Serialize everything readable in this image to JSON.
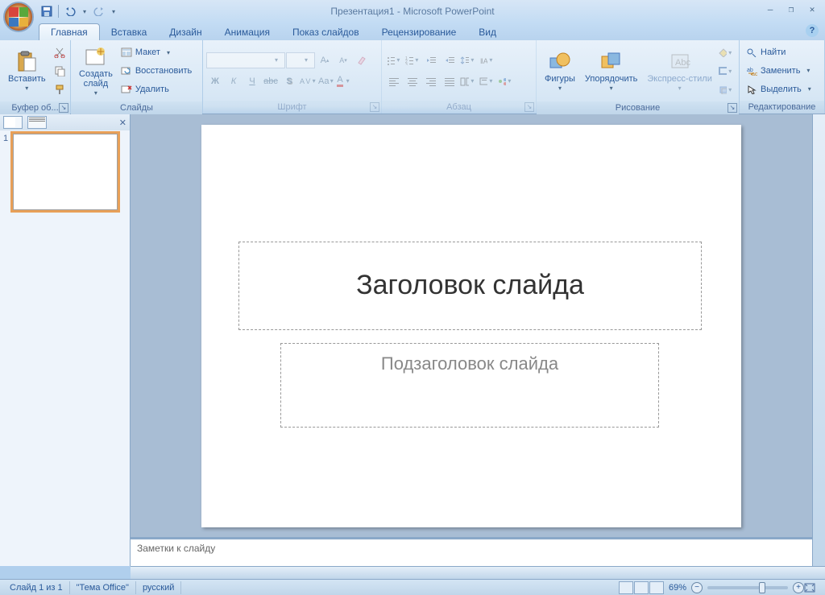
{
  "title": "Презентация1 - Microsoft PowerPoint",
  "qat": {
    "save": "💾",
    "undo": "↶",
    "redo": "↷"
  },
  "tabs": [
    "Главная",
    "Вставка",
    "Дизайн",
    "Анимация",
    "Показ слайдов",
    "Рецензирование",
    "Вид"
  ],
  "ribbon": {
    "clipboard": {
      "paste": "Вставить",
      "label": "Буфер об..."
    },
    "slides": {
      "new": "Создать\nслайд",
      "layout": "Макет",
      "reset": "Восстановить",
      "delete": "Удалить",
      "label": "Слайды"
    },
    "font": {
      "label": "Шрифт"
    },
    "paragraph": {
      "label": "Абзац"
    },
    "drawing": {
      "shapes": "Фигуры",
      "arrange": "Упорядочить",
      "quickstyles": "Экспресс-стили",
      "label": "Рисование"
    },
    "editing": {
      "find": "Найти",
      "replace": "Заменить",
      "select": "Выделить",
      "label": "Редактирование"
    }
  },
  "slide": {
    "title_placeholder": "Заголовок слайда",
    "subtitle_placeholder": "Подзаголовок слайда"
  },
  "notes": "Заметки к слайду",
  "status": {
    "slide": "Слайд 1 из 1",
    "theme": "\"Тема Office\"",
    "lang": "русский",
    "zoom": "69%"
  },
  "thumb": {
    "num": "1"
  }
}
